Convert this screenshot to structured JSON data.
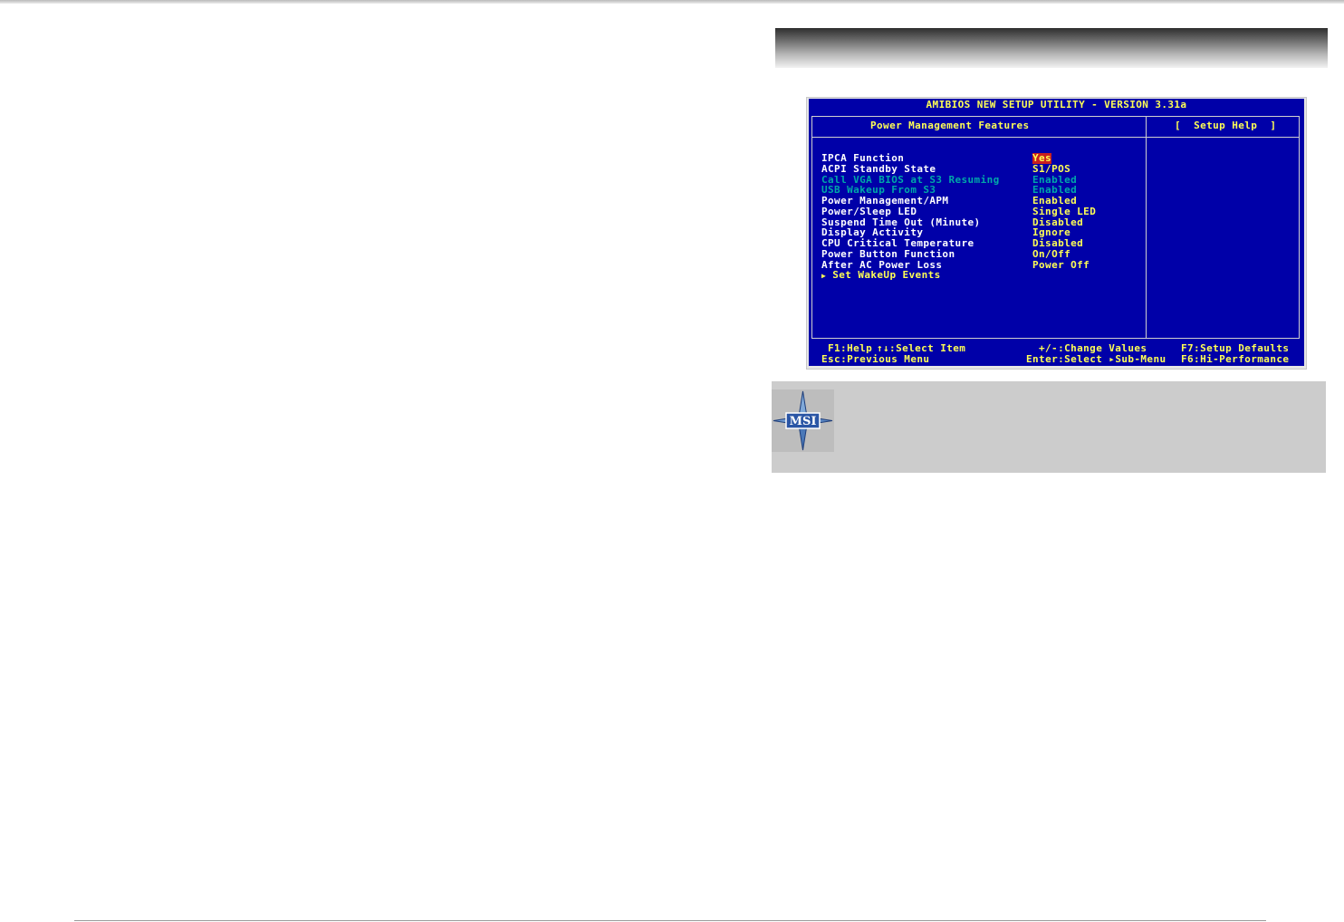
{
  "bios": {
    "title": "AMIBIOS NEW SETUP UTILITY - VERSION 3.31a",
    "section_title": "Power Management Features",
    "help_title": "[  Setup Help  ]",
    "settings": [
      {
        "label": "IPCA Function",
        "value": "Yes",
        "state": "selected"
      },
      {
        "label": "ACPI Standby State",
        "value": "S1/POS",
        "state": "normal"
      },
      {
        "label": "Call VGA BIOS at S3 Resuming",
        "value": "Enabled",
        "state": "disabled"
      },
      {
        "label": "USB Wakeup From S3",
        "value": "Enabled",
        "state": "disabled"
      },
      {
        "label": "Power Management/APM",
        "value": "Enabled",
        "state": "normal"
      },
      {
        "label": "Power/Sleep LED",
        "value": "Single LED",
        "state": "normal"
      },
      {
        "label": "Suspend Time Out (Minute)",
        "value": "Disabled",
        "state": "normal"
      },
      {
        "label": "Display Activity",
        "value": "Ignore",
        "state": "normal"
      },
      {
        "label": "CPU Critical Temperature",
        "value": "Disabled",
        "state": "normal"
      },
      {
        "label": "Power Button Function",
        "value": "On/Off",
        "state": "normal"
      },
      {
        "label": "After AC Power Loss",
        "value": "Power Off",
        "state": "normal"
      }
    ],
    "submenu_label": "Set WakeUp Events",
    "footer": {
      "help": "F1:Help",
      "select_item": "↑↓:Select Item",
      "change_values": "+/-:Change Values",
      "setup_defaults": "F7:Setup Defaults",
      "previous_menu": "Esc:Previous Menu",
      "select_submenu": "Enter:Select ▸Sub-Menu",
      "hi_performance": "F6:Hi-Performance"
    },
    "colors": {
      "background": "#0000a8",
      "title_text": "#ffff55",
      "label_text": "#ffffff",
      "disabled_text": "#00a8a8",
      "selected_bg": "#c81f1f"
    }
  },
  "note": {
    "logo_text": "MSI",
    "icon": "msi-compass-icon"
  }
}
